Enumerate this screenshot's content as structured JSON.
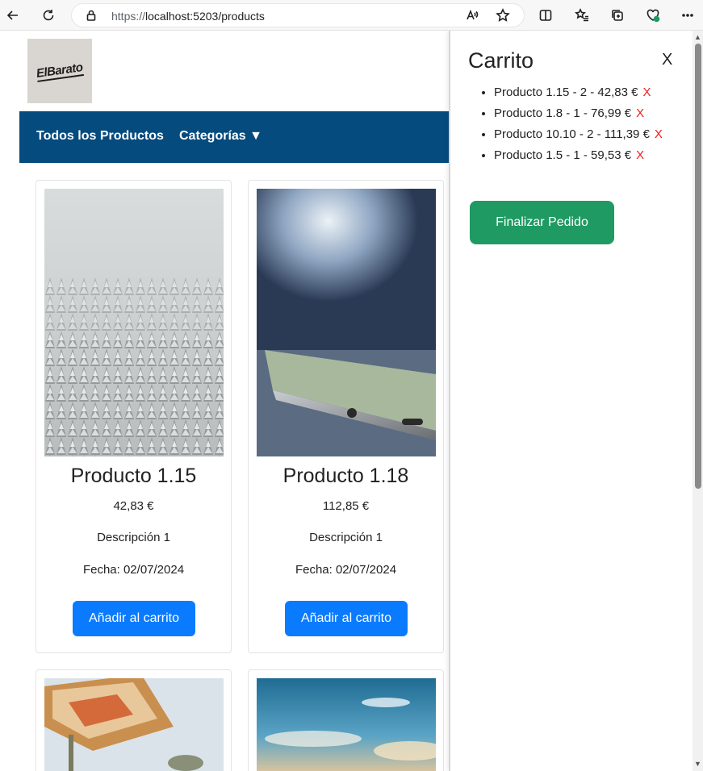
{
  "browser": {
    "url_scheme": "https://",
    "url_host": "localhost:5203/products"
  },
  "logo": {
    "text": "ElBarato"
  },
  "nav": {
    "all_products": "Todos los Productos",
    "categories": "Categorías ▼"
  },
  "products": [
    {
      "title": "Producto 1.15",
      "price": "42,83 €",
      "description": "Descripción 1",
      "date": "Fecha: 02/07/2024",
      "add_label": "Añadir al carrito"
    },
    {
      "title": "Producto 1.18",
      "price": "112,85 €",
      "description": "Descripción 1",
      "date": "Fecha: 02/07/2024",
      "add_label": "Añadir al carrito"
    }
  ],
  "cart": {
    "title": "Carrito",
    "close": "X",
    "items": [
      {
        "text": "Producto 1.15 - 2 - 42,83 €",
        "remove": "X"
      },
      {
        "text": "Producto 1.8 - 1 - 76,99 €",
        "remove": "X"
      },
      {
        "text": "Producto 10.10 - 2 - 111,39 €",
        "remove": "X"
      },
      {
        "text": "Producto 1.5 - 1 - 59,53 €",
        "remove": "X"
      }
    ],
    "checkout_label": "Finalizar Pedido"
  },
  "colors": {
    "navbar": "#054b7e",
    "primary_button": "#0a7bff",
    "checkout_button": "#1f9a63",
    "remove": "#ee1c1c"
  }
}
